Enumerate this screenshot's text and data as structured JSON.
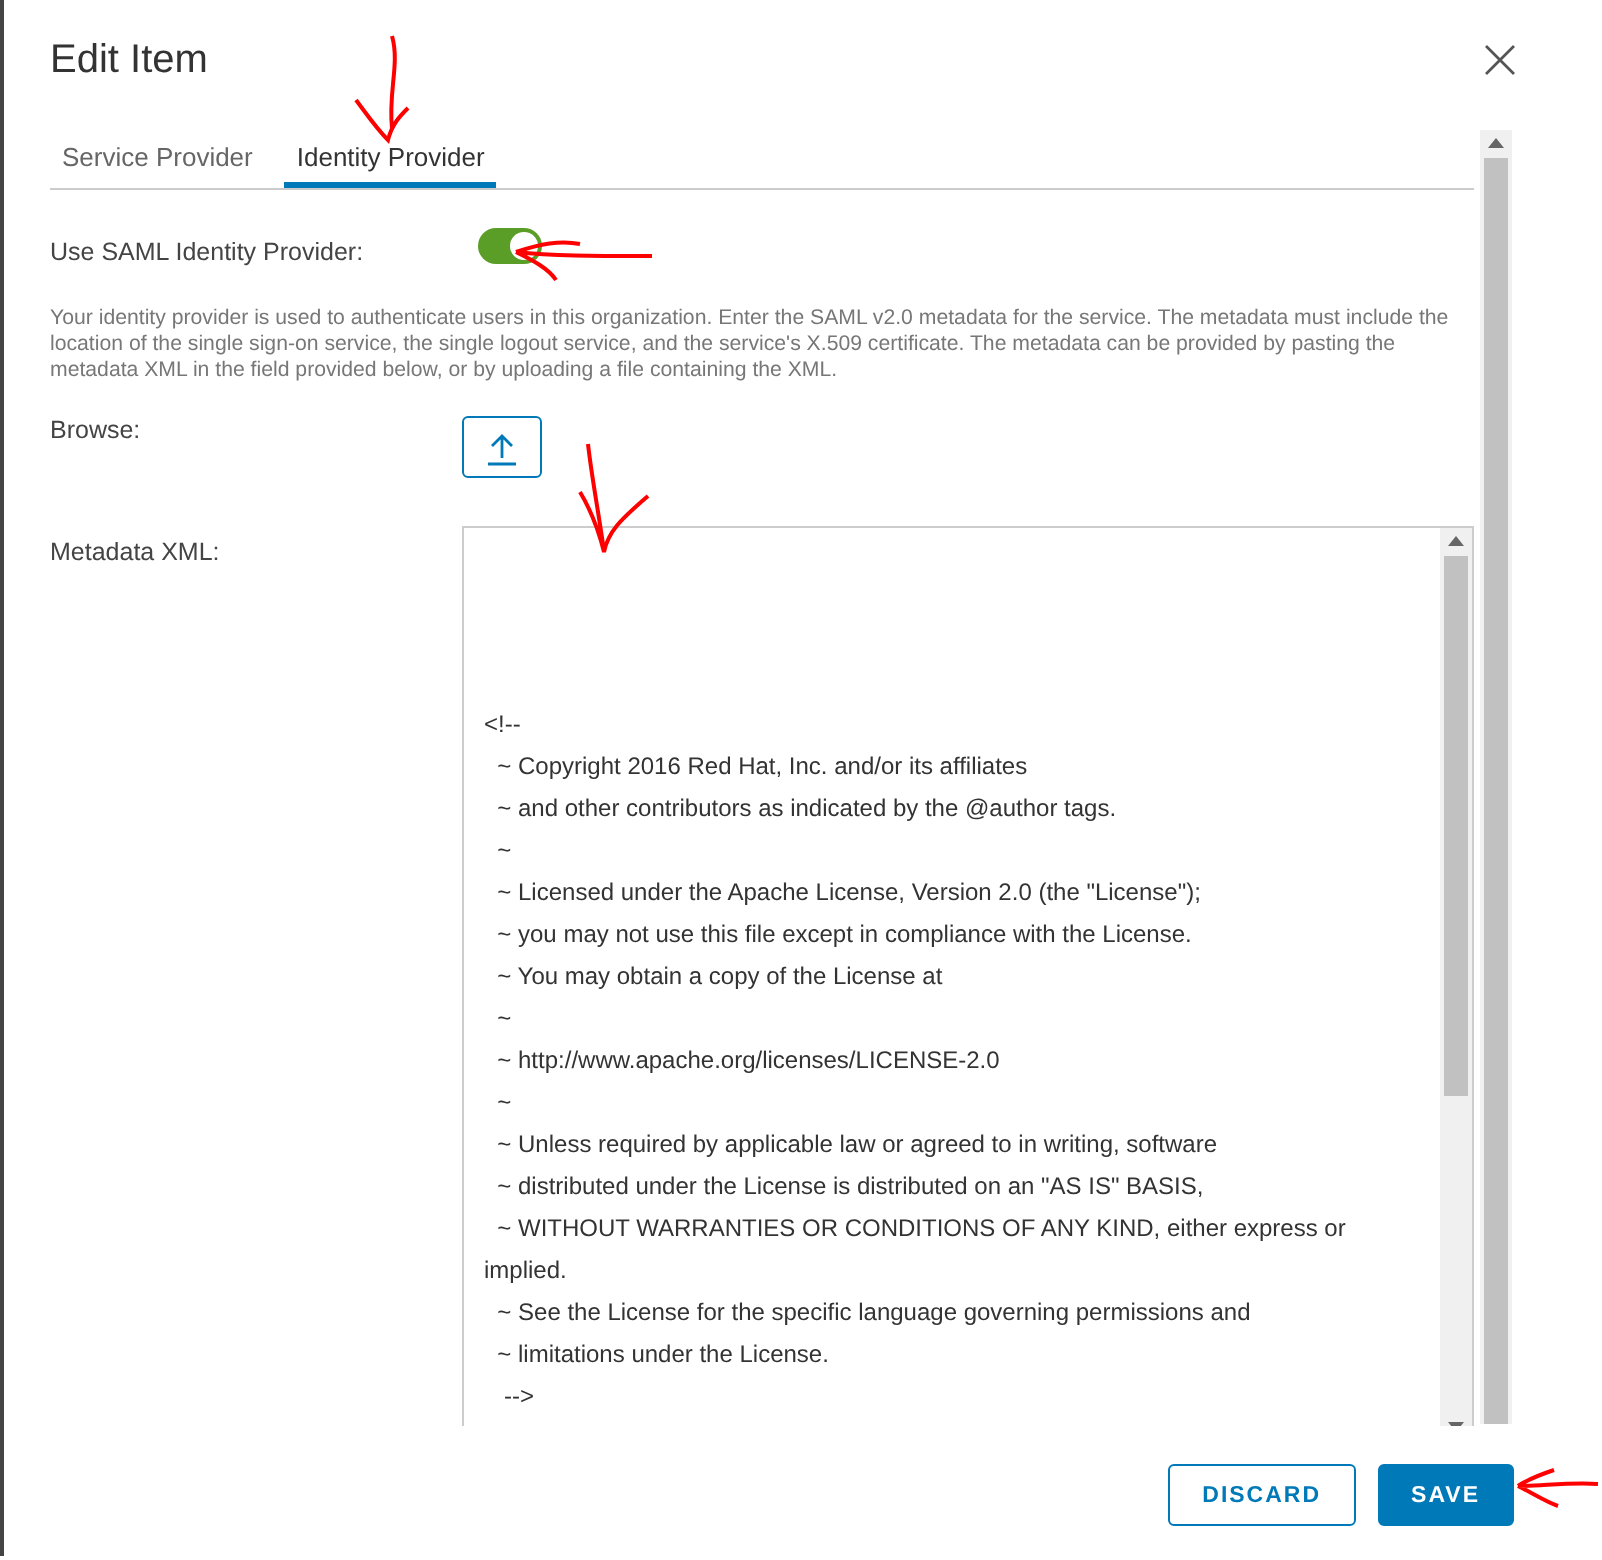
{
  "dialog": {
    "title": "Edit Item"
  },
  "tabs": [
    {
      "label": "Service Provider",
      "selected": false
    },
    {
      "label": "Identity Provider",
      "selected": true
    }
  ],
  "saml_toggle": {
    "label": "Use SAML Identity Provider:",
    "on": true
  },
  "description": "Your identity provider is used to authenticate users in this organization. Enter the SAML v2.0 metadata for the service. The metadata must include the location of the single sign-on service, the single logout service, and the service's X.509 certificate. The metadata can be provided by pasting the metadata XML in the field provided below, or by uploading a file containing the XML.",
  "browse": {
    "label": "Browse:"
  },
  "metadata": {
    "label": "Metadata XML:",
    "lines": [
      "<!--",
      "  ~ Copyright 2016 Red Hat, Inc. and/or its affiliates",
      "  ~ and other contributors as indicated by the @author tags.",
      "  ~",
      "  ~ Licensed under the Apache License, Version 2.0 (the \"License\");",
      "  ~ you may not use this file except in compliance with the License.",
      "  ~ You may obtain a copy of the License at",
      "  ~",
      "  ~ http://www.apache.org/licenses/LICENSE-2.0",
      "  ~",
      "  ~ Unless required by applicable law or agreed to in writing, software",
      "  ~ distributed under the License is distributed on an \"AS IS\" BASIS,",
      "  ~ WITHOUT WARRANTIES OR CONDITIONS OF ANY KIND, either express or",
      "implied.",
      "  ~ See the License for the specific language governing permissions and",
      "  ~ limitations under the License.",
      "   -->"
    ]
  },
  "buttons": [
    {
      "label": "DISCARD",
      "kind": "secondary"
    },
    {
      "label": "SAVE",
      "kind": "primary"
    }
  ]
}
